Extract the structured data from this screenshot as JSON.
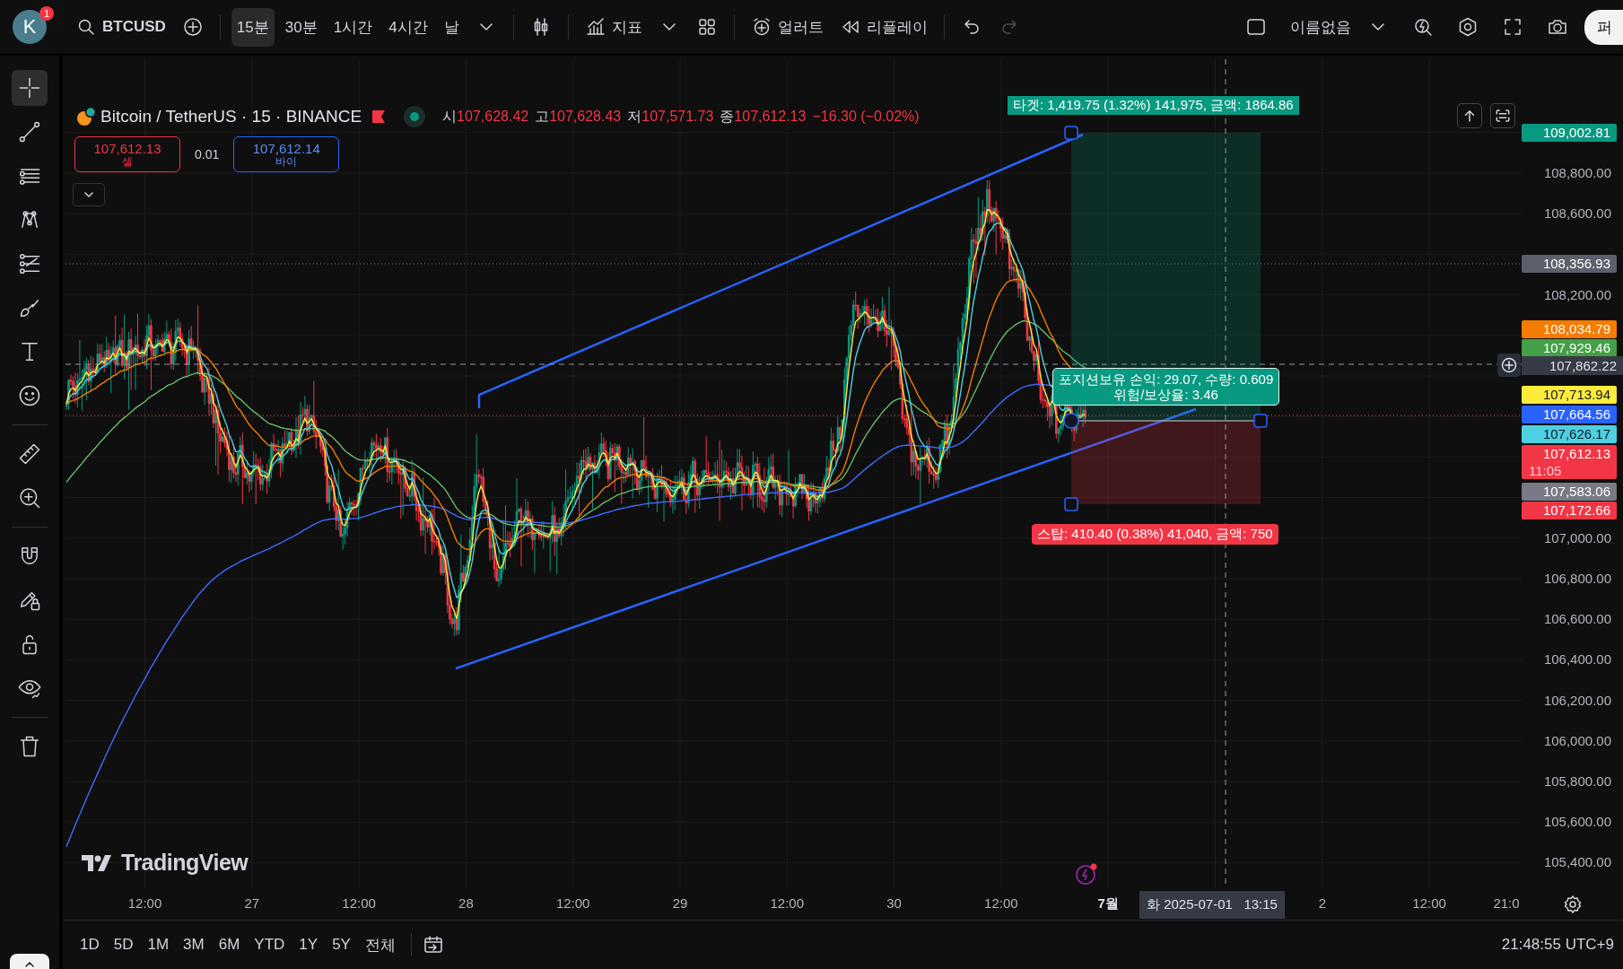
{
  "top_toolbar": {
    "avatar": {
      "letter": "K",
      "badge": "1"
    },
    "symbol": "BTCUSD",
    "intervals": [
      {
        "label": "15분",
        "selected": true
      },
      {
        "label": "30분",
        "selected": false
      },
      {
        "label": "1시간",
        "selected": false
      },
      {
        "label": "4시간",
        "selected": false
      },
      {
        "label": "날",
        "selected": false
      }
    ],
    "indicators": "지표",
    "alert": "얼러트",
    "replay": "리플레이",
    "undo": {
      "disabled": false
    },
    "redo": {
      "disabled": true
    },
    "layout_name": "이름없음",
    "publish": "퍼"
  },
  "drawing_tools": [
    [
      {
        "kind": "crosshair",
        "selected": true
      },
      {
        "kind": "trend_line",
        "selected": false
      },
      {
        "kind": "fib",
        "selected": false
      },
      {
        "kind": "pattern",
        "selected": false
      },
      {
        "kind": "forecast",
        "selected": false
      },
      {
        "kind": "brush",
        "selected": false
      },
      {
        "kind": "text",
        "selected": false
      },
      {
        "kind": "emoji",
        "selected": false
      }
    ],
    [
      {
        "kind": "ruler",
        "selected": false
      },
      {
        "kind": "zoom",
        "selected": false
      }
    ],
    [
      {
        "kind": "magnet",
        "selected": false
      },
      {
        "kind": "lock_drawing",
        "selected": false
      },
      {
        "kind": "lock",
        "selected": false
      },
      {
        "kind": "hide",
        "selected": false
      }
    ],
    [
      {
        "kind": "trash",
        "selected": false
      }
    ]
  ],
  "legend": {
    "title": "Bitcoin / TetherUS · 15 · BINANCE",
    "ohlc": [
      {
        "label": "시",
        "value": "107,628.42"
      },
      {
        "label": "고",
        "value": "107,628.43"
      },
      {
        "label": "저",
        "value": "107,571.73"
      },
      {
        "label": "종",
        "value": "107,612.13"
      }
    ],
    "change": "−16.30 (−0.02%)"
  },
  "trade_panel": {
    "sell_price": "107,612.13",
    "sell_label": "셀",
    "spread": "0.01",
    "buy_price": "107,612.14",
    "buy_label": "바이"
  },
  "position": {
    "target_label": "타겟: 1,419.75 (1.32%) 141,975, 금액: 1864.86",
    "info": [
      "포지션보유 손익: 29.07, 수량: 0.609",
      "위험/보상율: 3.46"
    ],
    "stop_label": "스탑: 410.40 (0.38%) 41,040, 금액: 750"
  },
  "price_axis": {
    "ticks": [
      "108,800.00",
      "108,600.00",
      "108,200.00",
      "107,000.00",
      "106,800.00",
      "106,600.00",
      "106,400.00",
      "106,200.00",
      "106,000.00",
      "105,800.00",
      "105,600.00",
      "105,400.00"
    ],
    "tags": [
      {
        "text": "109,002.81",
        "color": "#089981"
      },
      {
        "text": "108,356.93",
        "color": "#5d606b"
      },
      {
        "text": "108,034.79",
        "color": "#f57c00"
      },
      {
        "text": "107,929.46",
        "color": "#43a047"
      },
      {
        "text": "107,713.94",
        "color": "#ffeb3b"
      },
      {
        "text": "107,664.56",
        "color": "#2962ff"
      },
      {
        "text": "107,626.17",
        "color": "#4dd0e1"
      },
      {
        "text": "107,612.13",
        "sub": "11:05",
        "color": "#f23645"
      },
      {
        "text": "107,583.06",
        "color": "#787b86"
      },
      {
        "text": "107,172.66",
        "color": "#f23645"
      }
    ],
    "crosshair_price": "107,862.22"
  },
  "time_axis": {
    "labels": [
      {
        "text": "12:00",
        "bold": false
      },
      {
        "text": "27",
        "bold": false
      },
      {
        "text": "12:00",
        "bold": false
      },
      {
        "text": "28",
        "bold": false
      },
      {
        "text": "12:00",
        "bold": false
      },
      {
        "text": "29",
        "bold": false
      },
      {
        "text": "12:00",
        "bold": false
      },
      {
        "text": "30",
        "bold": false
      },
      {
        "text": "12:00",
        "bold": false
      },
      {
        "text": "7월",
        "bold": true
      },
      {
        "text": "2",
        "bold": false
      },
      {
        "text": "12:00",
        "bold": false
      },
      {
        "text": "21:0",
        "bold": false
      }
    ],
    "crosshair_time": "화 2025-07-01   13:15"
  },
  "brand": "TradingView",
  "ranges": [
    "1D",
    "5D",
    "1M",
    "3M",
    "6M",
    "YTD",
    "1Y",
    "5Y",
    "전체"
  ],
  "clock": "21:48:55 UTC+9"
}
